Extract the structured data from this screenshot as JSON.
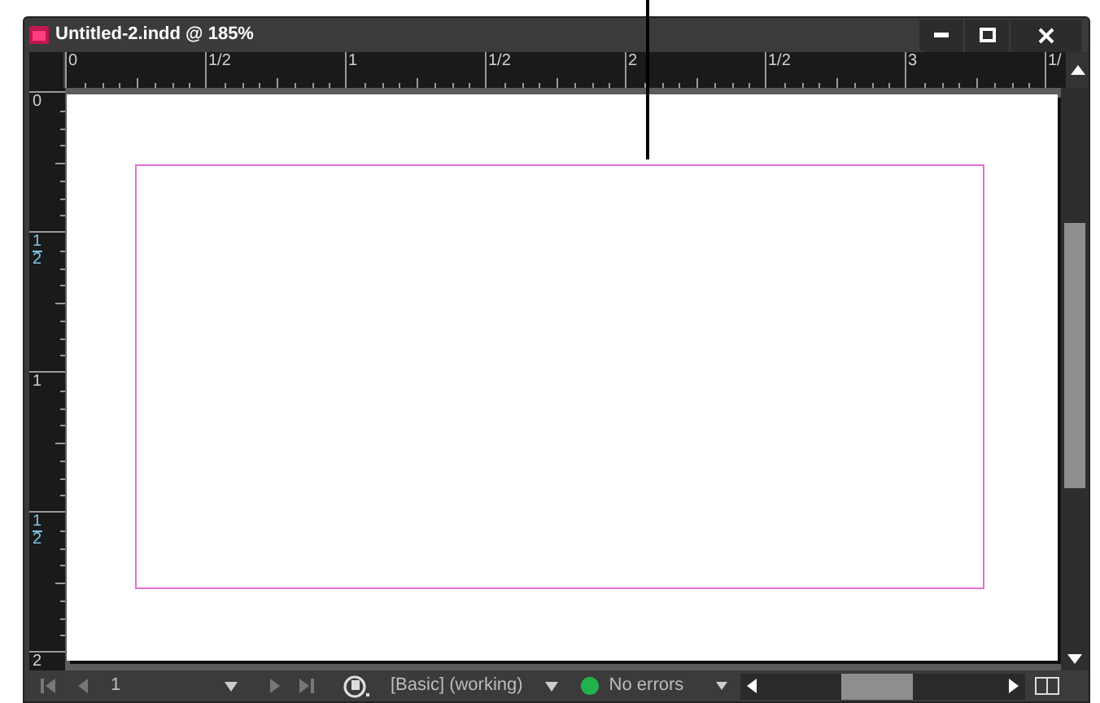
{
  "window": {
    "title": "Untitled-2.indd @ 185%"
  },
  "horizontal_ruler": {
    "labels": [
      "0",
      "1/2",
      "1",
      "1/2",
      "2",
      "1/2",
      "3",
      "1/"
    ]
  },
  "vertical_ruler": {
    "labels": [
      [
        "0"
      ],
      [
        "1",
        "2"
      ],
      [
        "1"
      ],
      [
        "1",
        "2"
      ],
      [
        "2"
      ]
    ]
  },
  "status_bar": {
    "page": "1",
    "preflight_profile": "[Basic] (working)",
    "preflight_status": "No errors"
  }
}
